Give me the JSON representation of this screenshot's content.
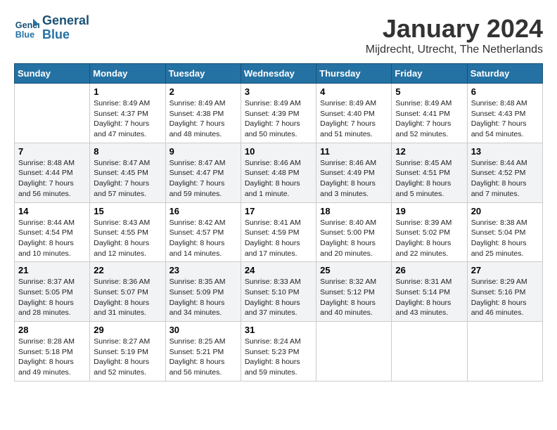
{
  "header": {
    "logo_line1": "General",
    "logo_line2": "Blue",
    "title": "January 2024",
    "subtitle": "Mijdrecht, Utrecht, The Netherlands"
  },
  "days_of_week": [
    "Sunday",
    "Monday",
    "Tuesday",
    "Wednesday",
    "Thursday",
    "Friday",
    "Saturday"
  ],
  "weeks": [
    [
      {
        "num": "",
        "detail": ""
      },
      {
        "num": "1",
        "detail": "Sunrise: 8:49 AM\nSunset: 4:37 PM\nDaylight: 7 hours\nand 47 minutes."
      },
      {
        "num": "2",
        "detail": "Sunrise: 8:49 AM\nSunset: 4:38 PM\nDaylight: 7 hours\nand 48 minutes."
      },
      {
        "num": "3",
        "detail": "Sunrise: 8:49 AM\nSunset: 4:39 PM\nDaylight: 7 hours\nand 50 minutes."
      },
      {
        "num": "4",
        "detail": "Sunrise: 8:49 AM\nSunset: 4:40 PM\nDaylight: 7 hours\nand 51 minutes."
      },
      {
        "num": "5",
        "detail": "Sunrise: 8:49 AM\nSunset: 4:41 PM\nDaylight: 7 hours\nand 52 minutes."
      },
      {
        "num": "6",
        "detail": "Sunrise: 8:48 AM\nSunset: 4:43 PM\nDaylight: 7 hours\nand 54 minutes."
      }
    ],
    [
      {
        "num": "7",
        "detail": "Sunrise: 8:48 AM\nSunset: 4:44 PM\nDaylight: 7 hours\nand 56 minutes."
      },
      {
        "num": "8",
        "detail": "Sunrise: 8:47 AM\nSunset: 4:45 PM\nDaylight: 7 hours\nand 57 minutes."
      },
      {
        "num": "9",
        "detail": "Sunrise: 8:47 AM\nSunset: 4:47 PM\nDaylight: 7 hours\nand 59 minutes."
      },
      {
        "num": "10",
        "detail": "Sunrise: 8:46 AM\nSunset: 4:48 PM\nDaylight: 8 hours\nand 1 minute."
      },
      {
        "num": "11",
        "detail": "Sunrise: 8:46 AM\nSunset: 4:49 PM\nDaylight: 8 hours\nand 3 minutes."
      },
      {
        "num": "12",
        "detail": "Sunrise: 8:45 AM\nSunset: 4:51 PM\nDaylight: 8 hours\nand 5 minutes."
      },
      {
        "num": "13",
        "detail": "Sunrise: 8:44 AM\nSunset: 4:52 PM\nDaylight: 8 hours\nand 7 minutes."
      }
    ],
    [
      {
        "num": "14",
        "detail": "Sunrise: 8:44 AM\nSunset: 4:54 PM\nDaylight: 8 hours\nand 10 minutes."
      },
      {
        "num": "15",
        "detail": "Sunrise: 8:43 AM\nSunset: 4:55 PM\nDaylight: 8 hours\nand 12 minutes."
      },
      {
        "num": "16",
        "detail": "Sunrise: 8:42 AM\nSunset: 4:57 PM\nDaylight: 8 hours\nand 14 minutes."
      },
      {
        "num": "17",
        "detail": "Sunrise: 8:41 AM\nSunset: 4:59 PM\nDaylight: 8 hours\nand 17 minutes."
      },
      {
        "num": "18",
        "detail": "Sunrise: 8:40 AM\nSunset: 5:00 PM\nDaylight: 8 hours\nand 20 minutes."
      },
      {
        "num": "19",
        "detail": "Sunrise: 8:39 AM\nSunset: 5:02 PM\nDaylight: 8 hours\nand 22 minutes."
      },
      {
        "num": "20",
        "detail": "Sunrise: 8:38 AM\nSunset: 5:04 PM\nDaylight: 8 hours\nand 25 minutes."
      }
    ],
    [
      {
        "num": "21",
        "detail": "Sunrise: 8:37 AM\nSunset: 5:05 PM\nDaylight: 8 hours\nand 28 minutes."
      },
      {
        "num": "22",
        "detail": "Sunrise: 8:36 AM\nSunset: 5:07 PM\nDaylight: 8 hours\nand 31 minutes."
      },
      {
        "num": "23",
        "detail": "Sunrise: 8:35 AM\nSunset: 5:09 PM\nDaylight: 8 hours\nand 34 minutes."
      },
      {
        "num": "24",
        "detail": "Sunrise: 8:33 AM\nSunset: 5:10 PM\nDaylight: 8 hours\nand 37 minutes."
      },
      {
        "num": "25",
        "detail": "Sunrise: 8:32 AM\nSunset: 5:12 PM\nDaylight: 8 hours\nand 40 minutes."
      },
      {
        "num": "26",
        "detail": "Sunrise: 8:31 AM\nSunset: 5:14 PM\nDaylight: 8 hours\nand 43 minutes."
      },
      {
        "num": "27",
        "detail": "Sunrise: 8:29 AM\nSunset: 5:16 PM\nDaylight: 8 hours\nand 46 minutes."
      }
    ],
    [
      {
        "num": "28",
        "detail": "Sunrise: 8:28 AM\nSunset: 5:18 PM\nDaylight: 8 hours\nand 49 minutes."
      },
      {
        "num": "29",
        "detail": "Sunrise: 8:27 AM\nSunset: 5:19 PM\nDaylight: 8 hours\nand 52 minutes."
      },
      {
        "num": "30",
        "detail": "Sunrise: 8:25 AM\nSunset: 5:21 PM\nDaylight: 8 hours\nand 56 minutes."
      },
      {
        "num": "31",
        "detail": "Sunrise: 8:24 AM\nSunset: 5:23 PM\nDaylight: 8 hours\nand 59 minutes."
      },
      {
        "num": "",
        "detail": ""
      },
      {
        "num": "",
        "detail": ""
      },
      {
        "num": "",
        "detail": ""
      }
    ]
  ]
}
